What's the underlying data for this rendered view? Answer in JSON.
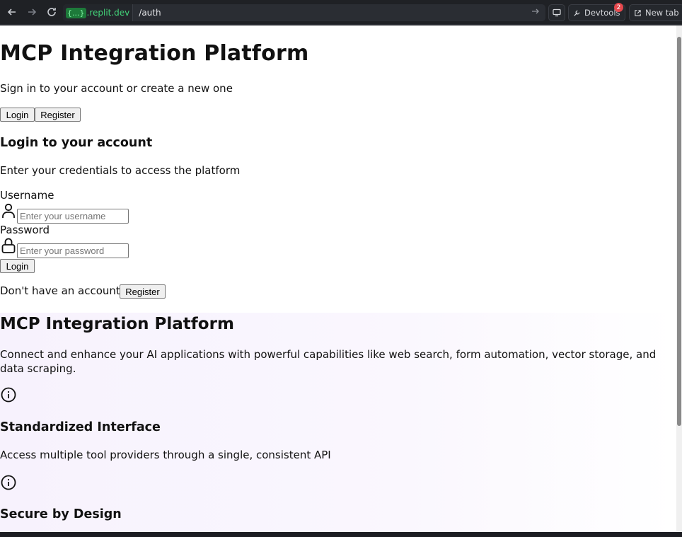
{
  "browser": {
    "domain_badge": "{...}",
    "domain": ".replit.dev",
    "path": "/auth",
    "devtools_label": "Devtools",
    "devtools_count": "2",
    "newtab_label": "New tab"
  },
  "page": {
    "title": "MCP Integration Platform",
    "subtitle": "Sign in to your account or create a new one",
    "tabs": {
      "login": "Login",
      "register": "Register"
    },
    "login_heading": "Login to your account",
    "login_description": "Enter your credentials to access the platform",
    "username_label": "Username",
    "username_placeholder": "Enter your username",
    "password_label": "Password",
    "password_placeholder": "Enter your password",
    "submit_label": "Login",
    "no_account_text": "Don't have an account?",
    "register_link_label": "Register"
  },
  "features": {
    "heading": "MCP Integration Platform",
    "description": "Connect and enhance your AI applications with powerful capabilities like web search, form automation, vector storage, and data scraping.",
    "items": [
      {
        "icon": "info-icon",
        "title": "Standardized Interface",
        "description": "Access multiple tool providers through a single, consistent API"
      },
      {
        "icon": "info-icon",
        "title": "Secure by Design",
        "description": ""
      }
    ]
  }
}
